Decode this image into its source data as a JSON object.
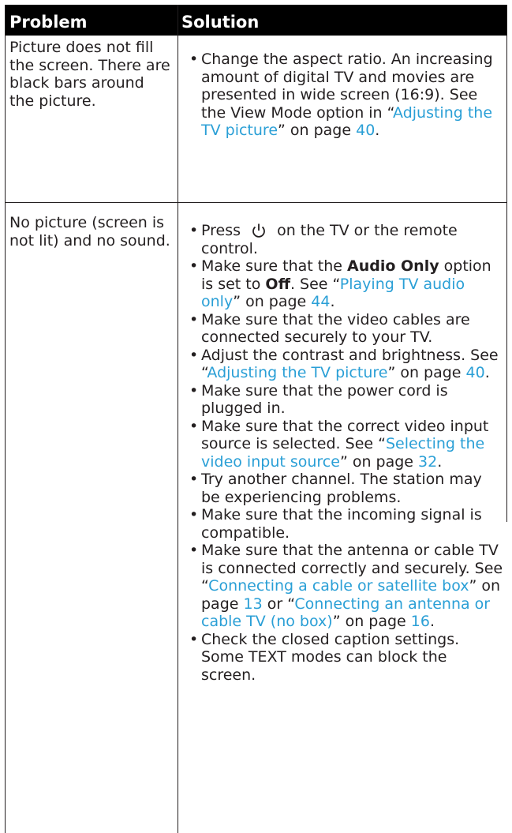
{
  "table": {
    "header": {
      "problem": "Problem",
      "solution": "Solution"
    },
    "rows": [
      {
        "problem": "Picture does not fill the screen. There are black bars around the picture.",
        "solutions": [
          {
            "text": "Change the aspect ratio. An increasing amount of digital TV and movies are presented in wide screen (16:9). See the View Mode option in “",
            "link": "Adjusting the TV picture",
            "after": "” on page ",
            "page": "40",
            "end": "."
          }
        ]
      },
      {
        "problem": "No picture (screen is not lit) and no sound.",
        "solutions": [
          {
            "pre": "Press ",
            "icon": "power-icon",
            "post": " on the TV or the remote control."
          },
          {
            "pre": "Make sure that the ",
            "bold1": "Audio Only",
            "mid": " option is set to ",
            "bold2": "Off",
            "post": ". See “",
            "link": "Playing TV audio only",
            "after": "” on page ",
            "page": "44",
            "end": "."
          },
          {
            "text": "Make sure that the video cables are connected securely to your TV."
          },
          {
            "pre": "Adjust the contrast and brightness. See “",
            "link": "Adjusting the TV picture",
            "after": "” on page ",
            "page": "40",
            "end": "."
          },
          {
            "text": "Make sure that the power cord is plugged in."
          },
          {
            "pre": "Make sure that the correct video input source is selected. See “",
            "link": "Selecting the video input source",
            "after": "” on page ",
            "page": "32",
            "end": "."
          },
          {
            "text": "Try another channel. The station may be experiencing problems."
          },
          {
            "text": "Make sure that the incoming signal is compatible."
          },
          {
            "pre": "Make sure that the antenna or cable TV is connected correctly and securely. See “",
            "link": "Connecting a cable or satellite box",
            "after": "” on page ",
            "page": "13",
            "mid2": " or “",
            "link2": "Connecting an antenna or cable TV (no box)",
            "after2": "” on page ",
            "page2": "16",
            "end": "."
          },
          {
            "text": "Check the closed caption settings. Some TEXT modes can block the screen."
          }
        ]
      }
    ]
  },
  "colors": {
    "link": "#2a9fd6",
    "header_bg": "#000000",
    "rule": "#231f20"
  }
}
